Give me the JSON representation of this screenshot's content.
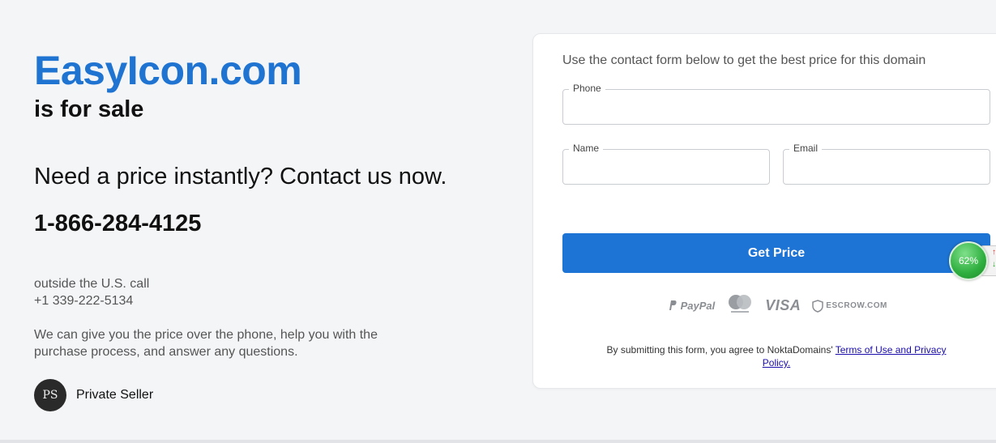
{
  "hero": {
    "domain": "EasyIcon.com",
    "subtitle": "is for sale",
    "cta_heading": "Need a price instantly? Contact us now.",
    "phone_main": "1-866-284-4125",
    "outside_label": "outside the U.S. call",
    "phone_intl": "+1 339-222-5134",
    "description": "We can give you the price over the phone, help you with the purchase process, and answer any questions."
  },
  "seller": {
    "initials": "PS",
    "name": "Private Seller"
  },
  "form": {
    "intro": "Use the contact form below to get the best price for this domain",
    "phone_label": "Phone",
    "name_label": "Name",
    "email_label": "Email",
    "submit_label": "Get Price",
    "payments": {
      "paypal": "PayPal",
      "visa": "VISA",
      "escrow": "ESCROW.COM"
    },
    "terms_prefix": "By submitting this form, you agree to NoktaDomains'",
    "terms_link": "Terms of Use and Privacy Policy."
  },
  "widget": {
    "percent": "62%"
  },
  "colors": {
    "brand_blue": "#1f74d2",
    "button_blue": "#1d74d4",
    "background": "#f4f5f7"
  }
}
